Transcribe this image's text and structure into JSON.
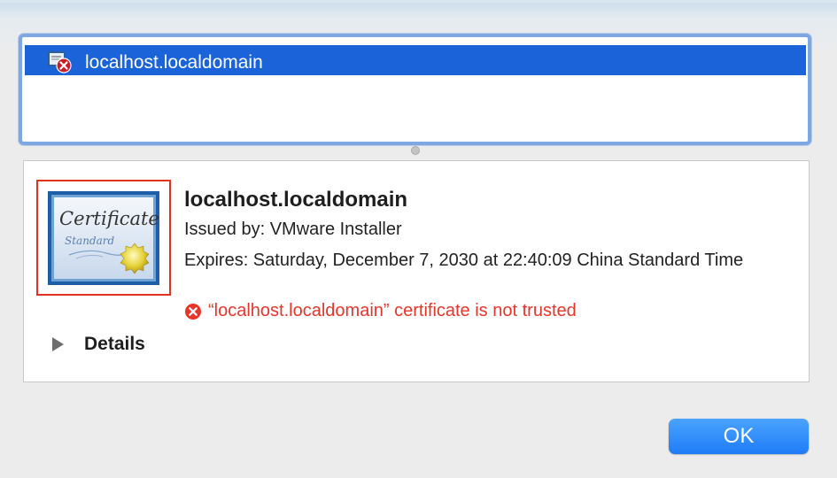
{
  "certificate_list": {
    "selected_item": {
      "label": "localhost.localdomain",
      "icon": "certificate-invalid-icon"
    }
  },
  "certificate_details": {
    "icon": "certificate-icon",
    "icon_texts": [
      "Certificate",
      "Standard"
    ],
    "name": "localhost.localdomain",
    "issued_by": "Issued by: VMware Installer",
    "expires": "Expires: Saturday, December 7, 2030 at 22:40:09 China Standard Time",
    "trust_status": "“localhost.localdomain” certificate is not trusted",
    "trust_status_color": "#e8352a",
    "details_label": "Details"
  },
  "buttons": {
    "ok_label": "OK"
  },
  "colors": {
    "selection": "#1b63d8",
    "accent_button": "#1f7cf6",
    "highlight_frame": "#e0331f"
  }
}
